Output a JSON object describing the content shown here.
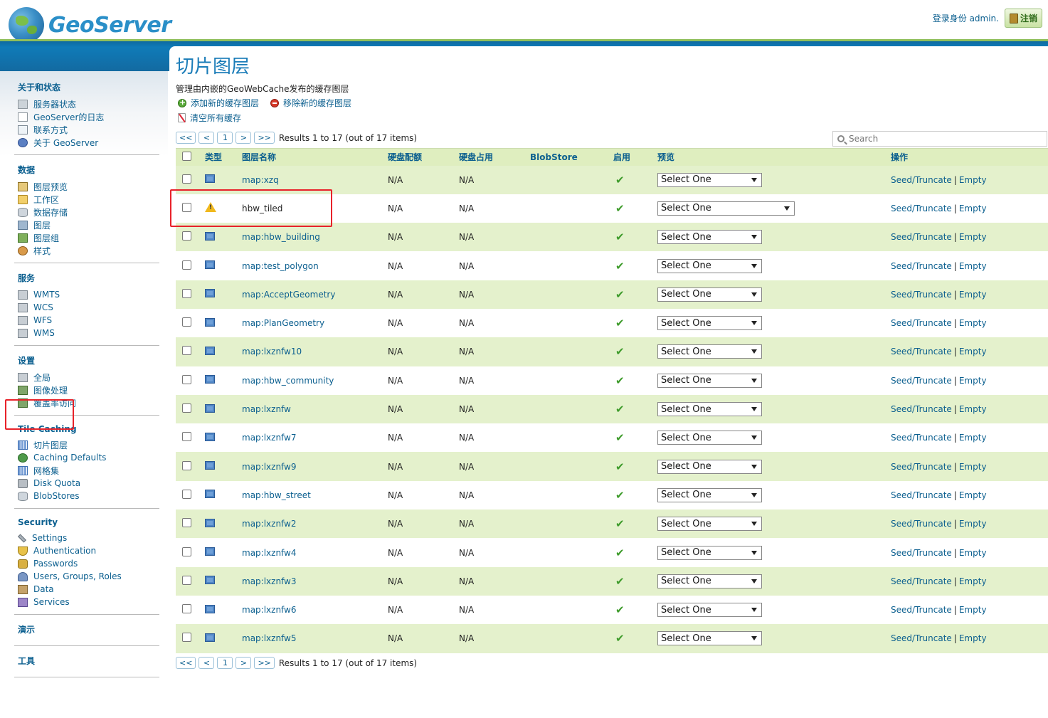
{
  "header": {
    "logo_text": "GeoServer",
    "login_label": "登录身份 admin.",
    "logout_label": "注销"
  },
  "sidebar": {
    "sections": [
      {
        "title": "关于和状态",
        "items": [
          {
            "label": "服务器状态",
            "icon": "server-status-icon",
            "cls": "ni-grey"
          },
          {
            "label": "GeoServer的日志",
            "icon": "log-icon",
            "cls": "ni-doc"
          },
          {
            "label": "联系方式",
            "icon": "contact-icon",
            "cls": "ni-card"
          },
          {
            "label": "关于 GeoServer",
            "icon": "info-icon",
            "cls": "ni-info"
          }
        ]
      },
      {
        "title": "数据",
        "items": [
          {
            "label": "图层预览",
            "icon": "layer-preview-icon",
            "cls": "ni-preview"
          },
          {
            "label": "工作区",
            "icon": "folder-icon",
            "cls": "ni-folder"
          },
          {
            "label": "数据存储",
            "icon": "database-icon",
            "cls": "ni-db"
          },
          {
            "label": "图层",
            "icon": "layer-icon",
            "cls": "ni-layer"
          },
          {
            "label": "图层组",
            "icon": "layer-group-icon",
            "cls": "ni-group"
          },
          {
            "label": "样式",
            "icon": "style-icon",
            "cls": "ni-style"
          }
        ]
      },
      {
        "title": "服务",
        "items": [
          {
            "label": "WMTS",
            "icon": "wmts-icon",
            "cls": "ni-svc"
          },
          {
            "label": "WCS",
            "icon": "wcs-icon",
            "cls": "ni-svc"
          },
          {
            "label": "WFS",
            "icon": "wfs-icon",
            "cls": "ni-svc"
          },
          {
            "label": "WMS",
            "icon": "wms-icon",
            "cls": "ni-svc"
          }
        ]
      },
      {
        "title": "设置",
        "items": [
          {
            "label": "全局",
            "icon": "global-settings-icon",
            "cls": "ni-svc"
          },
          {
            "label": "图像处理",
            "icon": "image-processing-icon",
            "cls": "ni-img"
          },
          {
            "label": "覆盖率访问",
            "icon": "coverage-access-icon",
            "cls": "ni-img"
          }
        ]
      },
      {
        "title": "Tile Caching",
        "items": [
          {
            "label": "切片图层",
            "icon": "tile-layers-icon",
            "cls": "ni-grid"
          },
          {
            "label": "Caching Defaults",
            "icon": "caching-defaults-icon",
            "cls": "ni-globe"
          },
          {
            "label": "网格集",
            "icon": "gridset-icon",
            "cls": "ni-grid"
          },
          {
            "label": "Disk Quota",
            "icon": "disk-quota-icon",
            "cls": "ni-disk"
          },
          {
            "label": "BlobStores",
            "icon": "blobstores-icon",
            "cls": "ni-db"
          }
        ]
      },
      {
        "title": "Security",
        "items": [
          {
            "label": "Settings",
            "icon": "wrench-icon",
            "cls": "ni-wrench"
          },
          {
            "label": "Authentication",
            "icon": "shield-icon",
            "cls": "ni-shield"
          },
          {
            "label": "Passwords",
            "icon": "lock-icon",
            "cls": "ni-lock"
          },
          {
            "label": "Users, Groups, Roles",
            "icon": "users-icon",
            "cls": "ni-users"
          },
          {
            "label": "Data",
            "icon": "data-security-icon",
            "cls": "ni-data"
          },
          {
            "label": "Services",
            "icon": "services-security-icon",
            "cls": "ni-svc2"
          }
        ]
      },
      {
        "title": "演示",
        "items": []
      },
      {
        "title": "工具",
        "items": []
      }
    ]
  },
  "main": {
    "title": "切片图层",
    "subtitle": "管理由内嵌的GeoWebCache发布的缓存图层",
    "add_label": "添加新的缓存图层",
    "remove_label": "移除新的缓存图层",
    "clear_label": "清空所有缓存",
    "search_placeholder": "Search",
    "pager": {
      "first": "<<",
      "prev": "<",
      "page": "1",
      "next": ">",
      "last": ">>",
      "info": "Results 1 to 17 (out of 17 items)"
    },
    "columns": [
      "类型",
      "图层名称",
      "硬盘配额",
      "硬盘占用",
      "BlobStore",
      "启用",
      "预览",
      "操作"
    ],
    "rows": [
      {
        "name": "map:xzq",
        "warn": false
      },
      {
        "name": "hbw_tiled",
        "warn": true
      },
      {
        "name": "map:hbw_building",
        "warn": false
      },
      {
        "name": "map:test_polygon",
        "warn": false
      },
      {
        "name": "map:AcceptGeometry",
        "warn": false
      },
      {
        "name": "map:PlanGeometry",
        "warn": false
      },
      {
        "name": "map:lxznfw10",
        "warn": false
      },
      {
        "name": "map:hbw_community",
        "warn": false
      },
      {
        "name": "map:lxznfw",
        "warn": false
      },
      {
        "name": "map:lxznfw7",
        "warn": false
      },
      {
        "name": "map:lxznfw9",
        "warn": false
      },
      {
        "name": "map:hbw_street",
        "warn": false
      },
      {
        "name": "map:lxznfw2",
        "warn": false
      },
      {
        "name": "map:lxznfw4",
        "warn": false
      },
      {
        "name": "map:lxznfw3",
        "warn": false
      },
      {
        "name": "map:lxznfw6",
        "warn": false
      },
      {
        "name": "map:lxznfw5",
        "warn": false
      }
    ],
    "row_quota": "N/A",
    "row_usage": "N/A",
    "row_preview": "Select One",
    "row_seed": "Seed/Truncate",
    "row_sep": "|",
    "row_empty": "Empty"
  }
}
